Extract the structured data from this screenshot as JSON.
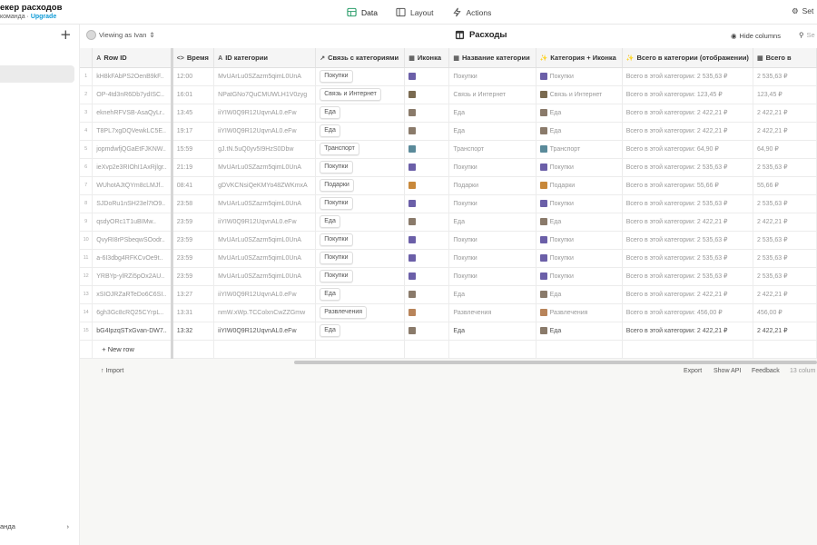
{
  "app": {
    "title": "екер расходов",
    "team": "команда",
    "upgrade": "Upgrade"
  },
  "tabs": [
    {
      "label": "Data"
    },
    {
      "label": "Layout"
    },
    {
      "label": "Actions"
    }
  ],
  "settings_label": "Set",
  "sidebar": {
    "footer": "анда"
  },
  "toolbar": {
    "viewing": "Viewing as Ivan",
    "table_title": "Расходы",
    "hide_columns": "Hide columns",
    "search_placeholder": "Se"
  },
  "columns": [
    {
      "label": "Row ID",
      "icon": "A"
    },
    {
      "label": "Время",
      "icon": "<>"
    },
    {
      "label": "ID категории",
      "icon": "A"
    },
    {
      "label": "Связь с категориями",
      "icon": "↗"
    },
    {
      "label": "Иконка",
      "icon": "▦"
    },
    {
      "label": "Название категории",
      "icon": "▦"
    },
    {
      "label": "Категория + Иконка",
      "icon": "✨"
    },
    {
      "label": "Всего в категории (отображении)",
      "icon": "✨"
    },
    {
      "label": "Всего в",
      "icon": "▦"
    }
  ],
  "rows": [
    {
      "n": "1",
      "rowid": "kH8kFAbPS2OenB9kF..",
      "time": "12:00",
      "catid": "MvUArLu0SZazm5qimL0UnA",
      "rel": "Покупки",
      "name": "Покупки",
      "combo": "Покупки",
      "disp": "Всего в этой категории: 2 535,63 ₽",
      "total": "2 535,63 ₽",
      "color": "#6b5fa8"
    },
    {
      "n": "2",
      "rowid": "OP-4td3nR6Db7ydISC..",
      "time": "16:01",
      "catid": "NPatGNo7QuCMUWLH1V0zyg",
      "rel": "Связь и Интернет",
      "name": "Связь и Интернет",
      "combo": "Связь и Интернет",
      "disp": "Всего в этой категории: 123,45 ₽",
      "total": "123,45 ₽",
      "color": "#7a6a50"
    },
    {
      "n": "3",
      "rowid": "eknehRFVSB-AsaQyLr..",
      "time": "13:45",
      "catid": "iiYIW0Q9R12UqvnAL0.eFw",
      "rel": "Еда",
      "name": "Еда",
      "combo": "Еда",
      "disp": "Всего в этой категории: 2 422,21 ₽",
      "total": "2 422,21 ₽",
      "color": "#8a7a6a"
    },
    {
      "n": "4",
      "rowid": "T8PL7xgDQVewkLC5E..",
      "time": "19:17",
      "catid": "iiYIW0Q9R12UqvnAL0.eFw",
      "rel": "Еда",
      "name": "Еда",
      "combo": "Еда",
      "disp": "Всего в этой категории: 2 422,21 ₽",
      "total": "2 422,21 ₽",
      "color": "#8a7a6a"
    },
    {
      "n": "5",
      "rowid": "jopmdwfjQGaEtFJKNW..",
      "time": "15:59",
      "catid": "gJ.tN.5uQ0yv5I9HzS0Dbw",
      "rel": "Транспорт",
      "name": "Транспорт",
      "combo": "Транспорт",
      "disp": "Всего в этой категории: 64,90 ₽",
      "total": "64,90 ₽",
      "color": "#5a8a9a"
    },
    {
      "n": "6",
      "rowid": "ieXvp2e3RIOhI1AxRjlgr..",
      "time": "21:19",
      "catid": "MvUArLu0SZazm5qimL0UnA",
      "rel": "Покупки",
      "name": "Покупки",
      "combo": "Покупки",
      "disp": "Всего в этой категории: 2 535,63 ₽",
      "total": "2 535,63 ₽",
      "color": "#6b5fa8"
    },
    {
      "n": "7",
      "rowid": "WUhotAJtQYm8cLMJf..",
      "time": "08:41",
      "catid": "gDVKCNsiQeKMYo48ZWKmxA",
      "rel": "Подарки",
      "name": "Подарки",
      "combo": "Подарки",
      "disp": "Всего в этой категории: 55,66 ₽",
      "total": "55,66 ₽",
      "color": "#c8883a"
    },
    {
      "n": "8",
      "rowid": "SJDoRu1nSH23el7tO9..",
      "time": "23:58",
      "catid": "MvUArLu0SZazm5qimL0UnA",
      "rel": "Покупки",
      "name": "Покупки",
      "combo": "Покупки",
      "disp": "Всего в этой категории: 2 535,63 ₽",
      "total": "2 535,63 ₽",
      "color": "#6b5fa8"
    },
    {
      "n": "9",
      "rowid": "qsdyORc1T1uBIMw..",
      "time": "23:59",
      "catid": "iiYIW0Q9R12UqvnAL0.eFw",
      "rel": "Еда",
      "name": "Еда",
      "combo": "Еда",
      "disp": "Всего в этой категории: 2 422,21 ₽",
      "total": "2 422,21 ₽",
      "color": "#8a7a6a"
    },
    {
      "n": "10",
      "rowid": "QvyRI8rPSbeqwSOodr..",
      "time": "23:59",
      "catid": "MvUArLu0SZazm5qimL0UnA",
      "rel": "Покупки",
      "name": "Покупки",
      "combo": "Покупки",
      "disp": "Всего в этой категории: 2 535,63 ₽",
      "total": "2 535,63 ₽",
      "color": "#6b5fa8"
    },
    {
      "n": "11",
      "rowid": "a-6I3dbg4RFKCvOe9t..",
      "time": "23:59",
      "catid": "MvUArLu0SZazm5qimL0UnA",
      "rel": "Покупки",
      "name": "Покупки",
      "combo": "Покупки",
      "disp": "Всего в этой категории: 2 535,63 ₽",
      "total": "2 535,63 ₽",
      "color": "#6b5fa8"
    },
    {
      "n": "12",
      "rowid": "YRBYp-ylRZi5pOx2AU..",
      "time": "23:59",
      "catid": "MvUArLu0SZazm5qimL0UnA",
      "rel": "Покупки",
      "name": "Покупки",
      "combo": "Покупки",
      "disp": "Всего в этой категории: 2 535,63 ₽",
      "total": "2 535,63 ₽",
      "color": "#6b5fa8"
    },
    {
      "n": "13",
      "rowid": "xSIOJRZaRTeDo6C6SI..",
      "time": "13:27",
      "catid": "iiYIW0Q9R12UqvnAL0.eFw",
      "rel": "Еда",
      "name": "Еда",
      "combo": "Еда",
      "disp": "Всего в этой категории: 2 422,21 ₽",
      "total": "2 422,21 ₽",
      "color": "#8a7a6a"
    },
    {
      "n": "14",
      "rowid": "6gh3Gc8cRQ25CYrpL..",
      "time": "13:31",
      "catid": "nmW.xWp.TCColxnCwZZGmw",
      "rel": "Развлечения",
      "name": "Развлечения",
      "combo": "Развлечения",
      "disp": "Всего в этой категории: 456,00 ₽",
      "total": "456,00 ₽",
      "color": "#b8845a"
    },
    {
      "n": "15",
      "rowid": "bG4IpzqSTxGvan-DW7..",
      "time": "13:32",
      "catid": "iiYIW0Q9R12UqvnAL0.eFw",
      "rel": "Еда",
      "name": "Еда",
      "combo": "Еда",
      "disp": "Всего в этой категории: 2 422,21 ₽",
      "total": "2 422,21 ₽",
      "color": "#8a7a6a",
      "last": true
    }
  ],
  "new_row": "New row",
  "footer": {
    "import": "Import",
    "export": "Export",
    "show_api": "Show API",
    "feedback": "Feedback",
    "columns": "13 colum"
  }
}
